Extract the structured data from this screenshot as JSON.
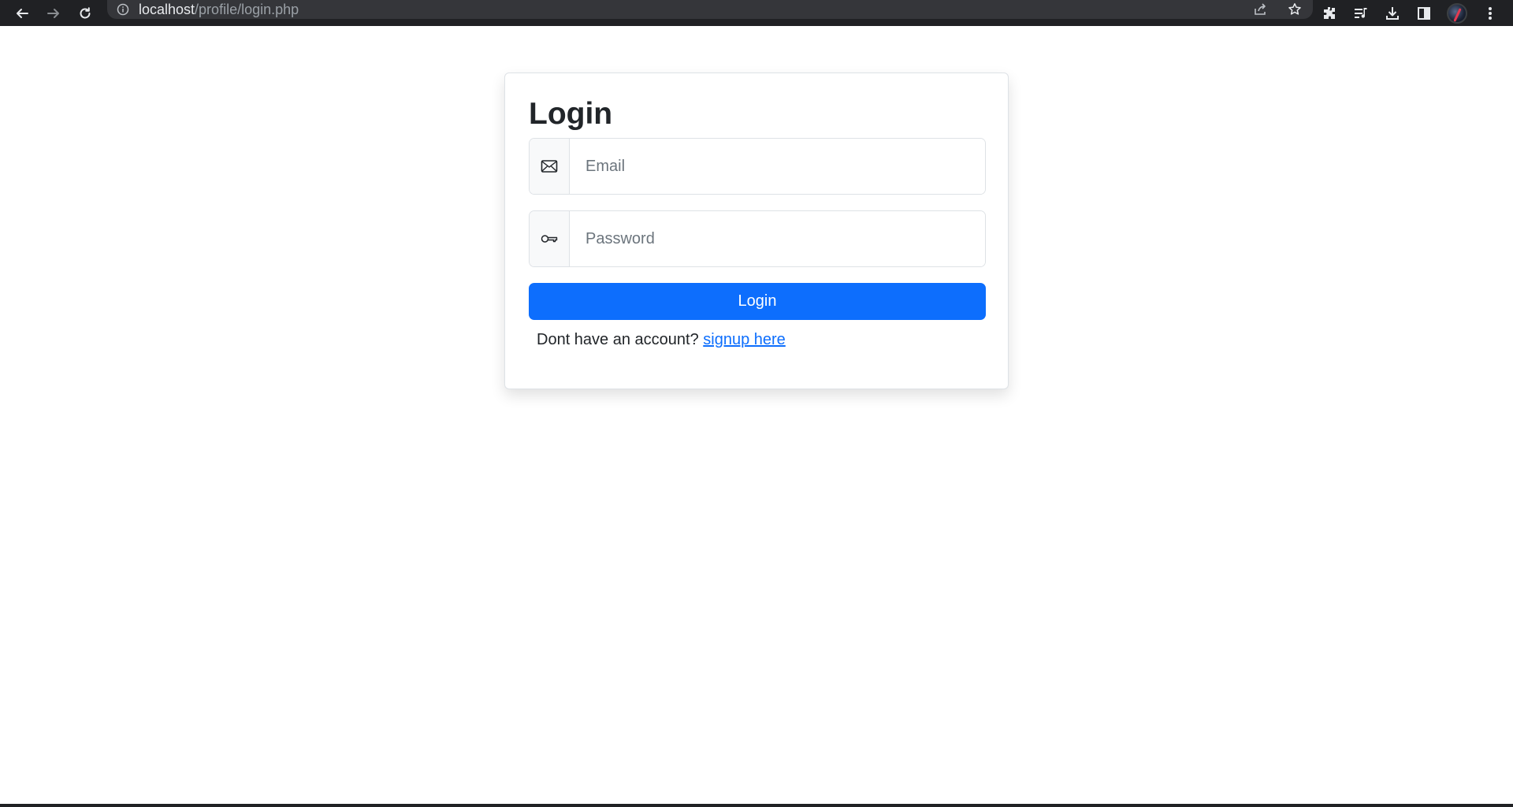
{
  "browser": {
    "url_host": "localhost",
    "url_path": "/profile/login.php",
    "icons": [
      "back-arrow-icon",
      "forward-arrow-icon",
      "reload-icon",
      "site-info-icon",
      "share-icon",
      "star-icon",
      "extensions-icon",
      "media-icon",
      "download-icon",
      "side-panel-icon",
      "profile-avatar",
      "menu-icon"
    ]
  },
  "login": {
    "title": "Login",
    "email_placeholder": "Email",
    "password_placeholder": "Password",
    "submit_label": "Login",
    "signup_prompt": "Dont have an account?",
    "signup_link": "signup here"
  },
  "colors": {
    "primary": "#0d6efd",
    "chrome_bg": "#202124",
    "omnibox_bg": "#35363a"
  }
}
